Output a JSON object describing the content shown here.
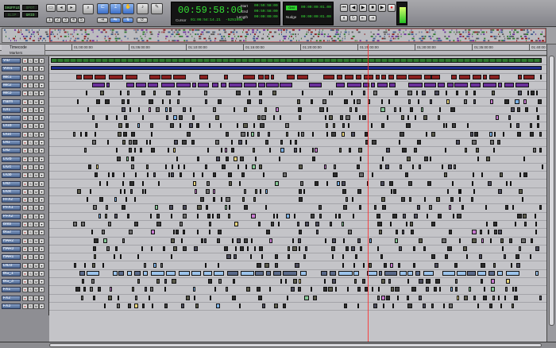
{
  "toolbar": {
    "modes": {
      "shuffle": "SHUFFLE",
      "spot": "SPOT",
      "slip": "SLIP",
      "grid": "GRID"
    },
    "main_counter": "00:59:58:00",
    "cursor_label": "Cursor",
    "cursor_value": "01:06:54:14.21",
    "cursor_extra": "-5251988",
    "selection": {
      "start_label": "Start",
      "end_label": "End",
      "length_label": "Length",
      "start": "00:59:58:00",
      "end": "00:59:58:00",
      "length": "00:00:00:00"
    },
    "grid_label": "Grid",
    "grid_value": "00:00:00:01.00",
    "nudge_label": "Nudge",
    "nudge_value": "00:00:00:01.00",
    "transport_icons": [
      "return-to-zero-icon",
      "rewind-icon",
      "fast-forward-icon",
      "stop-icon",
      "play-icon",
      "record-icon"
    ]
  },
  "ruler": {
    "label": "Timecode",
    "ticks": [
      "01:00:00:00",
      "01:05:00:00",
      "01:10:00:00",
      "01:15:00:00",
      "01:20:00:00",
      "01:25:00:00",
      "01:30:00:00",
      "01:35:00:00",
      "01:40:00:00"
    ]
  },
  "markers_label": "Markers",
  "tracks": [
    {
      "name": "VID",
      "color": "#2f7a2f"
    },
    {
      "name": "V001",
      "color": "#1c2a8a"
    },
    {
      "name": "Mic1",
      "color": "#8a1f1f"
    },
    {
      "name": "Mic2",
      "color": "#6a2f9a"
    },
    {
      "name": "Mic3",
      "color": "#5a5a5a"
    },
    {
      "name": "Harm",
      "color": "#4a4a4a"
    },
    {
      "name": "IDI1",
      "color": "#3a3a3a"
    },
    {
      "name": "IDI2",
      "color": "#3a3a3a"
    },
    {
      "name": "DI1b",
      "color": "#3a3a3a"
    },
    {
      "name": "DI1c",
      "color": "#3a3a3a"
    },
    {
      "name": "Dil1",
      "color": "#3a3a3a"
    },
    {
      "name": "Dil2",
      "color": "#3a3a3a"
    },
    {
      "name": "DI2b",
      "color": "#3a3a3a"
    },
    {
      "name": "DI2c",
      "color": "#3a3a3a"
    },
    {
      "name": "DI3b",
      "color": "#3a3a3a"
    },
    {
      "name": "Dil3",
      "color": "#3a3a3a"
    },
    {
      "name": "DI3c",
      "color": "#3a3a3a"
    },
    {
      "name": "FFX2",
      "color": "#3a3a3a"
    },
    {
      "name": "PFX1",
      "color": "#3a3a3a"
    },
    {
      "name": "PFX2",
      "color": "#3a3a3a"
    },
    {
      "name": "Bnts",
      "color": "#3a3a3a"
    },
    {
      "name": "BG2",
      "color": "#3a3a3a"
    },
    {
      "name": "HAR2",
      "color": "#3a3a3a"
    },
    {
      "name": "HAR3",
      "color": "#3a3a3a"
    },
    {
      "name": "HAR1",
      "color": "#3a3a3a"
    },
    {
      "name": "DID3",
      "color": "#3a3a3a"
    },
    {
      "name": "BG_1",
      "color": "#3a3a3a"
    },
    {
      "name": "BG_3",
      "color": "#3a3a3a"
    },
    {
      "name": "FX1",
      "color": "#3a3a3a"
    },
    {
      "name": "FX2",
      "color": "#3a3a3a"
    },
    {
      "name": "FX3",
      "color": "#3a3a3a"
    }
  ],
  "colors": {
    "counter_green": "#35e335",
    "playhead": "#ff2a2a",
    "track_name_blue": "#4a6590",
    "lane_bg": "#c4c4c8"
  }
}
